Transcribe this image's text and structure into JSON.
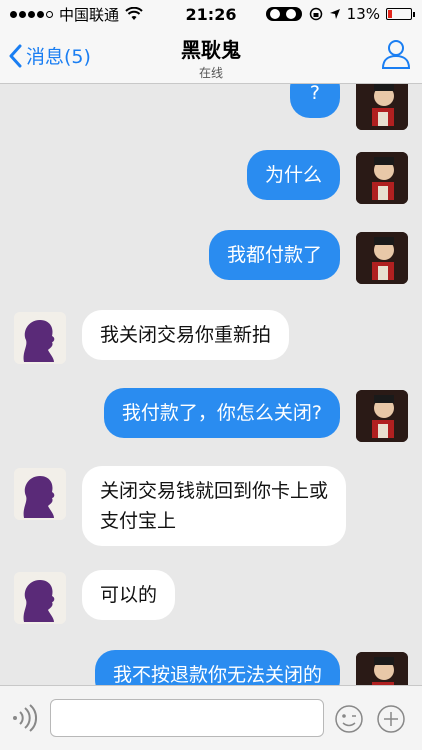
{
  "status_bar": {
    "carrier": "中国联通",
    "time": "21:26",
    "battery": "13%"
  },
  "nav": {
    "back_label": "消息(5)",
    "title": "黑耿鬼",
    "subtitle": "在线"
  },
  "messages": [
    {
      "sender": "me",
      "text": "?"
    },
    {
      "sender": "me",
      "text": "为什么"
    },
    {
      "sender": "me",
      "text": "我都付款了"
    },
    {
      "sender": "other",
      "text": "我关闭交易你重新拍"
    },
    {
      "sender": "me",
      "text": "我付款了，你怎么关闭?"
    },
    {
      "sender": "other",
      "text_line1": "关闭交易钱就回到你卡上或",
      "text_line2": "支付宝上"
    },
    {
      "sender": "other",
      "text": "可以的"
    },
    {
      "sender": "me",
      "text": "我不按退款你无法关闭的"
    }
  ],
  "input": {
    "placeholder": ""
  },
  "colors": {
    "accent": "#1a7ef2",
    "my_bubble": "#2a8cf0",
    "their_bubble": "#ffffff",
    "battery_low": "#e3261c"
  }
}
